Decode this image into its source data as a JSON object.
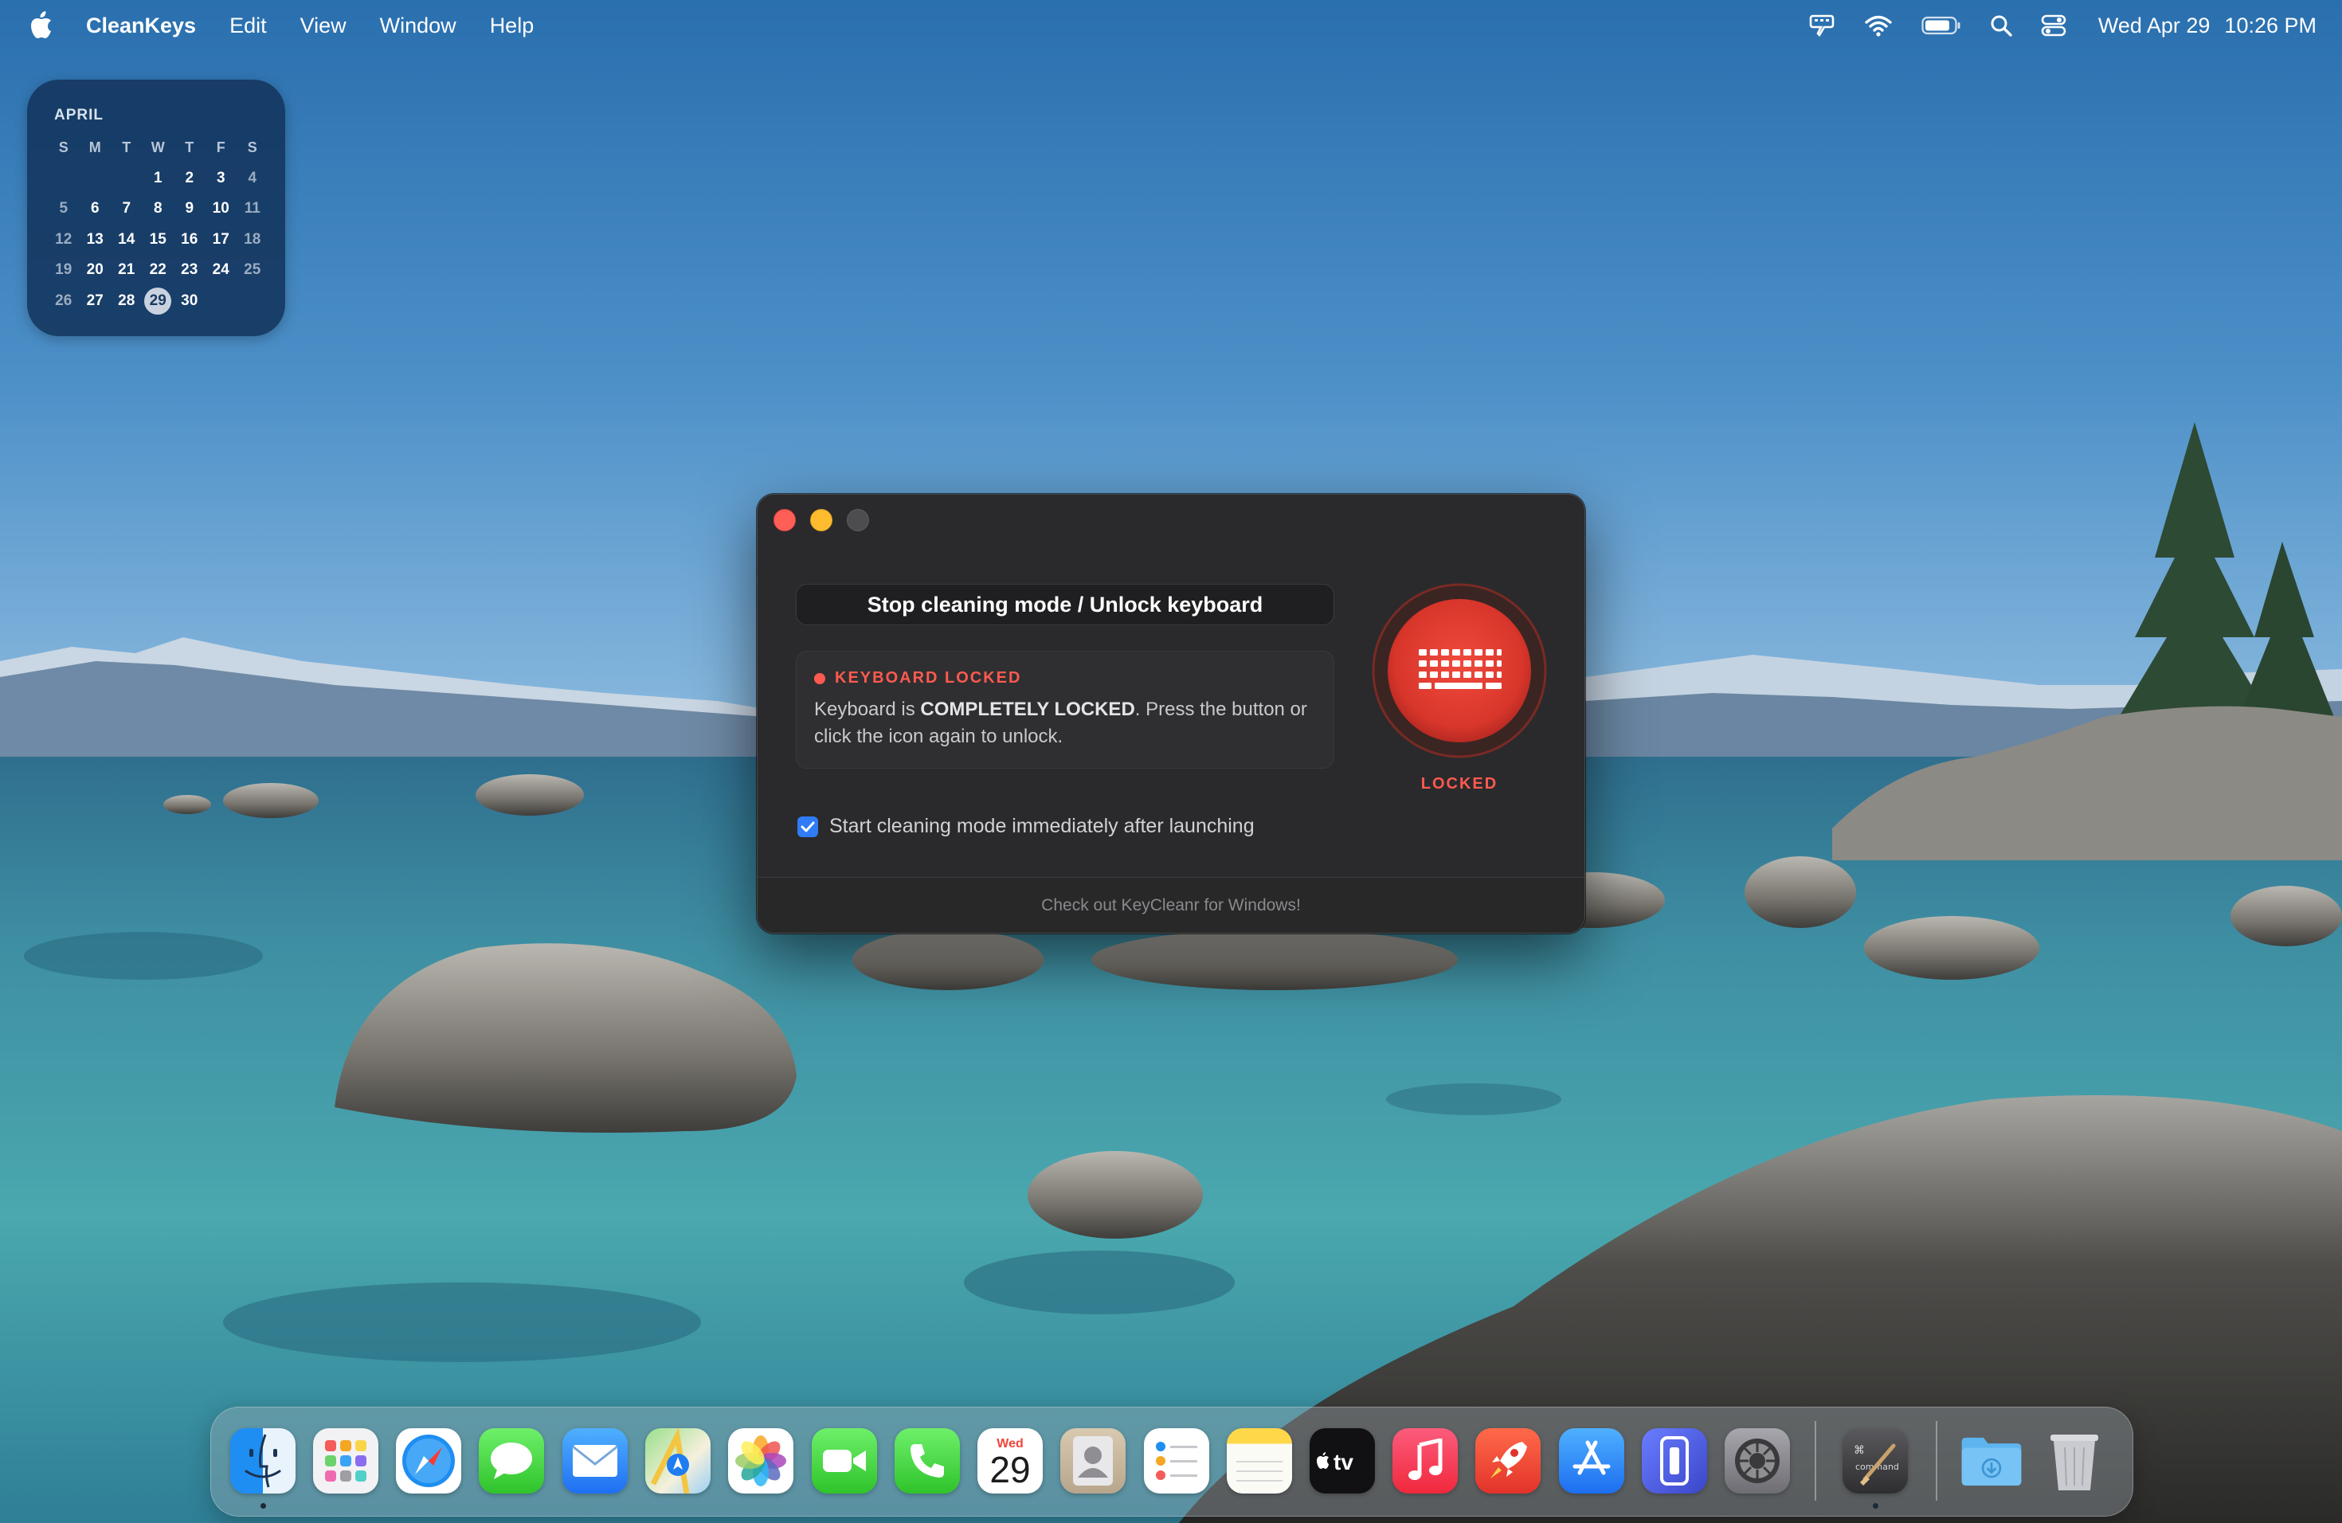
{
  "menubar": {
    "app_name": "CleanKeys",
    "menus": [
      "Edit",
      "View",
      "Window",
      "Help"
    ],
    "status_icons": [
      "keyboard-lock-icon",
      "wifi-icon",
      "battery-icon",
      "spotlight-icon",
      "control-center-icon"
    ],
    "date": "Wed Apr 29",
    "time": "10:26 PM"
  },
  "calendar": {
    "month": "APRIL",
    "weekdays": [
      "S",
      "M",
      "T",
      "W",
      "T",
      "F",
      "S"
    ],
    "weeks": [
      [
        "",
        "",
        "",
        "1",
        "2",
        "3",
        "4"
      ],
      [
        "5",
        "6",
        "7",
        "8",
        "9",
        "10",
        "11"
      ],
      [
        "12",
        "13",
        "14",
        "15",
        "16",
        "17",
        "18"
      ],
      [
        "19",
        "20",
        "21",
        "22",
        "23",
        "24",
        "25"
      ],
      [
        "26",
        "27",
        "28",
        "29",
        "30",
        "",
        ""
      ]
    ],
    "today": "29"
  },
  "window": {
    "unlock_button": "Stop cleaning mode / Unlock keyboard",
    "status_title": "KEYBOARD LOCKED",
    "status_msg_1": "Keyboard is ",
    "status_msg_bold": "COMPLETELY LOCKED",
    "status_msg_2": ". Press the button or click the icon again to unlock.",
    "checkbox_label": "Start cleaning mode immediately after launching",
    "checkbox_checked": true,
    "lock_label": "LOCKED",
    "footer_link": "Check out KeyCleanr for Windows!",
    "accent_color": "#ff5a4f"
  },
  "dock": {
    "apps": [
      "Finder",
      "Launchpad",
      "Safari",
      "Messages",
      "Mail",
      "Maps",
      "Photos",
      "FaceTime",
      "Phone",
      "Calendar",
      "Contacts",
      "Reminders",
      "Notes",
      "TV",
      "Music",
      "Rocket Typist",
      "App Store",
      "iPhone Mirroring",
      "System Settings",
      "Command Brush",
      "Downloads",
      "Trash"
    ],
    "calendar_icon": {
      "month": "Wed",
      "day": "29"
    }
  }
}
